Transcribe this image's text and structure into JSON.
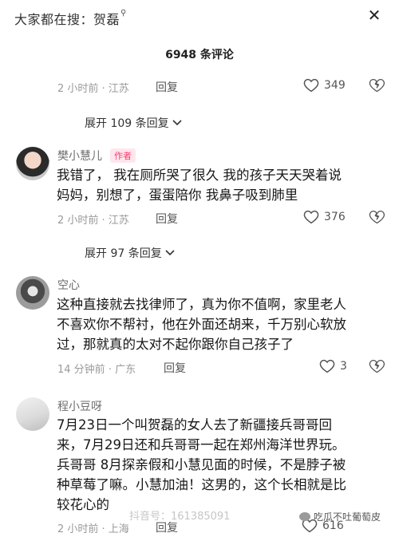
{
  "search": {
    "prefix": "大家都在搜：",
    "query": "贺磊"
  },
  "comment_count": "6948 条评论",
  "top_comment": {
    "time": "2 小时前 · 江苏",
    "reply": "回复",
    "likes": "349",
    "expand": "展开 109 条回复"
  },
  "comments": [
    {
      "username": "樊小慧儿",
      "badge": "作者",
      "text": [
        "我错了，  我在厕所哭了很久 我的孩子天天哭着说",
        "妈妈，别想了，蛋蛋陪你 我鼻子吸到肺里"
      ],
      "time": "2 小时前 · 江苏",
      "reply": "回复",
      "likes": "376",
      "expand": "展开 97 条回复"
    },
    {
      "username": "空心",
      "text": [
        "这种直接就去找律师了，真为你不值啊，家里老人",
        "不喜欢你不帮衬，他在外面还胡来，千万别心软放",
        "过，那就真的太对不起你跟你自己孩子了"
      ],
      "time": "14 分钟前 · 广东",
      "reply": "回复",
      "likes": "3"
    },
    {
      "username": "程小豆呀",
      "text": [
        "7月23日一个叫贺磊的女人去了新疆接兵哥哥回",
        "来，7月29日还和兵哥哥一起在郑州海洋世界玩。",
        "兵哥哥 8月探亲假和小慧见面的时候，不是脖子被",
        "种草莓了嘛。小慧加油！这男的，这个长相就是比",
        "较花心的"
      ],
      "time": "2 小时前 · 上海",
      "reply": "回复",
      "likes": "616"
    }
  ],
  "watermark": {
    "left": "抖音号：161385091",
    "right": "吃瓜不吐葡萄皮"
  }
}
